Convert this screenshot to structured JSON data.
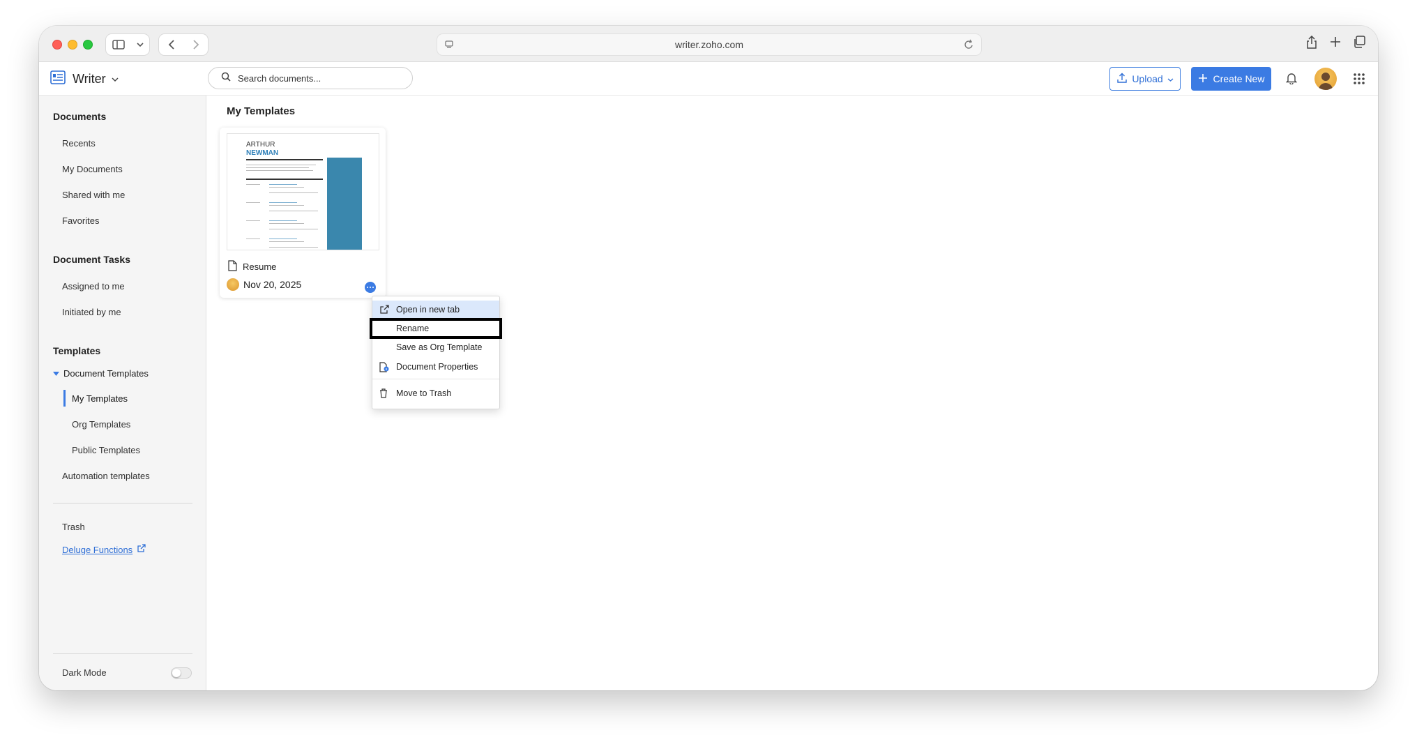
{
  "browser": {
    "url": "writer.zoho.com"
  },
  "header": {
    "app_name": "Writer",
    "search_placeholder": "Search documents...",
    "upload_label": "Upload",
    "create_label": "Create New"
  },
  "sidebar": {
    "documents_title": "Documents",
    "documents_items": [
      "Recents",
      "My Documents",
      "Shared with me",
      "Favorites"
    ],
    "tasks_title": "Document Tasks",
    "tasks_items": [
      "Assigned to me",
      "Initiated by me"
    ],
    "templates_title": "Templates",
    "document_templates": "Document Templates",
    "template_items": [
      "My Templates",
      "Org Templates",
      "Public Templates"
    ],
    "automation": "Automation templates",
    "trash": "Trash",
    "deluge": "Deluge Functions",
    "dark_mode": "Dark Mode"
  },
  "main": {
    "title": "My Templates",
    "card": {
      "thumb_name_first": "ARTHUR",
      "thumb_name_last": "NEWMAN",
      "name": "Resume",
      "date": "Nov 20, 2025"
    }
  },
  "context_menu": {
    "items": [
      "Open in new tab",
      "Rename",
      "Save as Org Template",
      "Document Properties",
      "Move to Trash"
    ]
  },
  "colors": {
    "accent": "#3b7be3",
    "thumb_column": "#3a87ad",
    "highlight": "#000000"
  }
}
